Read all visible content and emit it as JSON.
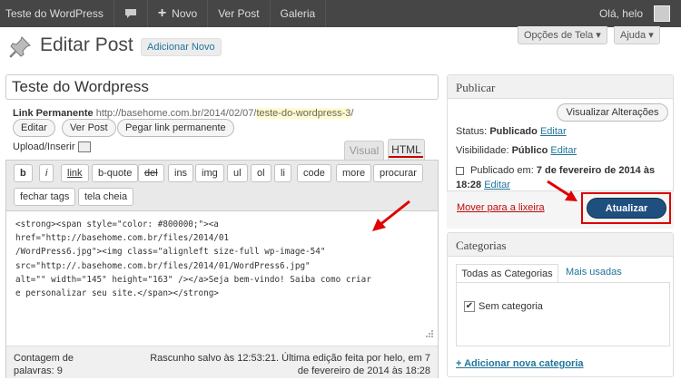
{
  "adminbar": {
    "site_name": "Teste do WordPress",
    "new_label": "Novo",
    "view_post": "Ver Post",
    "gallery": "Galeria",
    "greeting": "Olá, helo"
  },
  "header": {
    "title": "Editar Post",
    "add_new": "Adicionar Novo",
    "screen_options": "Opções de Tela ▾",
    "help": "Ajuda ▾"
  },
  "post": {
    "title": "Teste do Wordpress",
    "permalink_label": "Link Permanente",
    "permalink_base": "http://basehome.com.br/2014/02/07/",
    "permalink_slug": "teste-do-wordpress-3",
    "permalink_end": "/",
    "edit_btn": "Editar",
    "view_btn": "Ver Post",
    "shortlink_btn": "Pegar link permanente",
    "upload_label": "Upload/Inserir"
  },
  "editor": {
    "tab_visual": "Visual",
    "tab_html": "HTML",
    "buttons_row1": [
      "b",
      "i",
      "link",
      "b-quote",
      "del",
      "ins",
      "img",
      "ul",
      "ol",
      "li",
      "code",
      "more",
      "procurar"
    ],
    "buttons_row2": [
      "fechar tags",
      "tela cheia"
    ],
    "content_lines": [
      "<strong><span style=\"color: #800000;\"><a",
      "href=\"http://basehome.com.br/files/2014/01",
      "/WordPress6.jpg\"><img class=\"alignleft size-full wp-image-54\"",
      "src=\"http://.basehome.com.br/files/2014/01/WordPress6.jpg\"",
      "alt=\"\" width=\"145\" height=\"163\" /></a>Seja bem-vindo! Saiba como criar",
      "e personalizar seu site.</span></strong>"
    ],
    "word_count": "Contagem de palavras: 9",
    "draft_info": "Rascunho salvo às 12:53:21. Última edição feita por helo, em 7 de fevereiro de 2014 às 18:28"
  },
  "publish": {
    "heading": "Publicar",
    "preview_btn": "Visualizar Alterações",
    "status_label": "Status:",
    "status_value": "Publicado",
    "visibility_label": "Visibilidade:",
    "visibility_value": "Público",
    "edit_link": "Editar",
    "published_label": "Publicado em:",
    "published_date": "7 de fevereiro de 2014 às",
    "published_time": "18:28",
    "trash": "Mover para a lixeira",
    "update_btn": "Atualizar"
  },
  "categories": {
    "heading": "Categorias",
    "tab_all": "Todas as Categorias",
    "tab_used": "Mais usadas",
    "items": [
      {
        "label": "Sem categoria",
        "checked": true
      }
    ],
    "checkmark": "✔",
    "add_new": "+ Adicionar nova categoria"
  },
  "colors": {
    "adminbar": "#464646",
    "link": "#21759b",
    "update_button": "#1f4f7f",
    "highlight_red": "#d00000"
  }
}
